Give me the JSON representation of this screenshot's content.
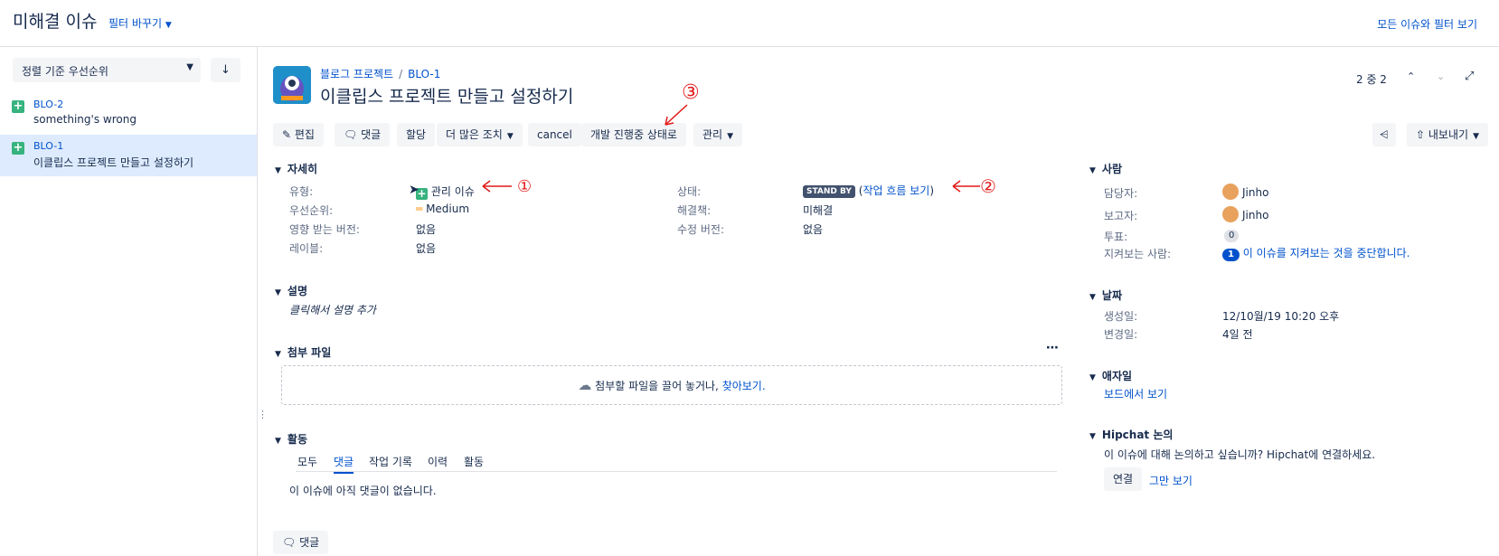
{
  "topbar": {
    "title": "미해결 이슈",
    "switch_filter": "필터 바꾸기",
    "all_issues_link": "모든 이슈와 필터 보기"
  },
  "left": {
    "sort_label": "정렬 기준 우선순위",
    "sort_dir_icon": "arrow-down-icon",
    "items": [
      {
        "key": "BLO-2",
        "summary": "something's wrong"
      },
      {
        "key": "BLO-1",
        "summary": "이클립스 프로젝트 만들고 설정하기"
      }
    ]
  },
  "issue": {
    "breadcrumb_project": "블로그 프로젝트",
    "breadcrumb_sep": "/",
    "key": "BLO-1",
    "title": "이클립스 프로젝트 만들고 설정하기",
    "pager": "2 중 2"
  },
  "toolbar": {
    "edit": "편집",
    "comment": "댓글",
    "assign": "할당",
    "more": "더 많은 조치",
    "cancel": "cancel",
    "transition": "개발 진행중 상태로",
    "admin": "관리",
    "export": "내보내기"
  },
  "details": {
    "section": "자세히",
    "type_label": "유형:",
    "type_value": "관리 이슈",
    "priority_label": "우선순위:",
    "priority_value": "Medium",
    "affects_label": "영향 받는 버전:",
    "affects_value": "없음",
    "labels_label": "레이블:",
    "labels_value": "없음",
    "status_label": "상태:",
    "status_value": "STAND BY",
    "workflow_open": "(",
    "workflow_link": "작업 흐름 보기",
    "workflow_close": ")",
    "resolution_label": "해결책:",
    "resolution_value": "미해결",
    "fix_label": "수정 버전:",
    "fix_value": "없음"
  },
  "description": {
    "section": "설명",
    "placeholder": "클릭해서 설명 추가"
  },
  "attachments": {
    "section": "첨부 파일",
    "drop_text": "첨부할 파일을 끌어 놓거나,",
    "browse": "찾아보기."
  },
  "activity": {
    "section": "활동",
    "tabs": [
      "모두",
      "댓글",
      "작업 기록",
      "이력",
      "활동"
    ],
    "active_tab": "댓글",
    "empty": "이 이슈에 아직 댓글이 없습니다.",
    "comment_btn": "댓글"
  },
  "people": {
    "section": "사람",
    "assignee_label": "담당자:",
    "assignee": "Jinho",
    "reporter_label": "보고자:",
    "reporter": "Jinho",
    "votes_label": "투표:",
    "votes": "0",
    "watchers_label": "지켜보는 사람:",
    "watchers": "1",
    "watch_link": "이 이슈를 지켜보는 것을 중단합니다."
  },
  "dates": {
    "section": "날짜",
    "created_label": "생성일:",
    "created": "12/10월/19 10:20 오후",
    "updated_label": "변경일:",
    "updated": "4일 전"
  },
  "agile": {
    "section": "애자일",
    "link": "보드에서 보기"
  },
  "hipchat": {
    "section": "Hipchat 논의",
    "text": "이 이슈에 대해 논의하고 싶습니까? Hipchat에 연결하세요.",
    "connect": "연결",
    "dismiss": "그만 보기"
  },
  "annotations": {
    "mark1": "①",
    "mark2": "②",
    "mark3": "③"
  },
  "colors": {
    "link": "#0052cc",
    "selected_bg": "#deebff",
    "status_lozenge": "#42526e",
    "annotation": "#e21a1a"
  }
}
